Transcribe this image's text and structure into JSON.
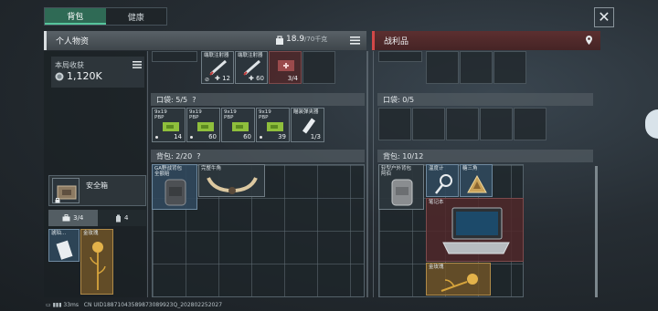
{
  "tabs": [
    {
      "label": "背包",
      "active": true
    },
    {
      "label": "健康",
      "active": false
    }
  ],
  "left_header": {
    "title": "个人物资",
    "weight_value": "18.9",
    "weight_limit": "/70千克"
  },
  "right_header": {
    "title": "战利品"
  },
  "earnings": {
    "label": "本局收获",
    "value": "1,120K"
  },
  "top_row_items": [
    {
      "label": "端联注射器",
      "count": "12"
    },
    {
      "label": "端联注射器",
      "count": "60"
    },
    {
      "label": "",
      "count": "3/4"
    }
  ],
  "pocket": {
    "title": "口袋: 5/5",
    "help": "?",
    "items": [
      {
        "label": "9x19\nPBP",
        "count": "14"
      },
      {
        "label": "9x19\nPBP",
        "count": "60"
      },
      {
        "label": "9x19\nPBP",
        "count": "60"
      },
      {
        "label": "9x19\nPBP",
        "count": "39"
      },
      {
        "label": "瞄装弹夹器",
        "count": "1/3"
      }
    ]
  },
  "backpack": {
    "title": "背包: 2/20",
    "help": "?",
    "items": [
      {
        "label": "GA野战背包\n全额赔"
      },
      {
        "label": "完整牛角"
      }
    ]
  },
  "safe_box": {
    "label": "安全箱"
  },
  "quick_tabs": [
    {
      "icon": "toolbox-icon",
      "count": "3/4"
    },
    {
      "icon": "flask-icon",
      "count": "4"
    }
  ],
  "quick_items": [
    {
      "label": "琥珀..."
    },
    {
      "label": "金玫瑰"
    }
  ],
  "loot_pocket": {
    "title": "口袋: 0/5"
  },
  "loot_backpack": {
    "title": "背包: 10/12",
    "items": [
      {
        "label": "轻型户外背包\n阿伯"
      },
      {
        "label": "温度计"
      },
      {
        "label": "糖三角"
      },
      {
        "label": "笔记本"
      },
      {
        "label": "金玫瑰"
      }
    ]
  },
  "status_bar": {
    "battery": "▭",
    "ping": "33ms",
    "uid": "CN UID18871043589873089923Q_202802252027"
  },
  "colors": {
    "accent_green": "#2f6a55",
    "loot_red": "#d24848",
    "gold": "#b08a48"
  }
}
